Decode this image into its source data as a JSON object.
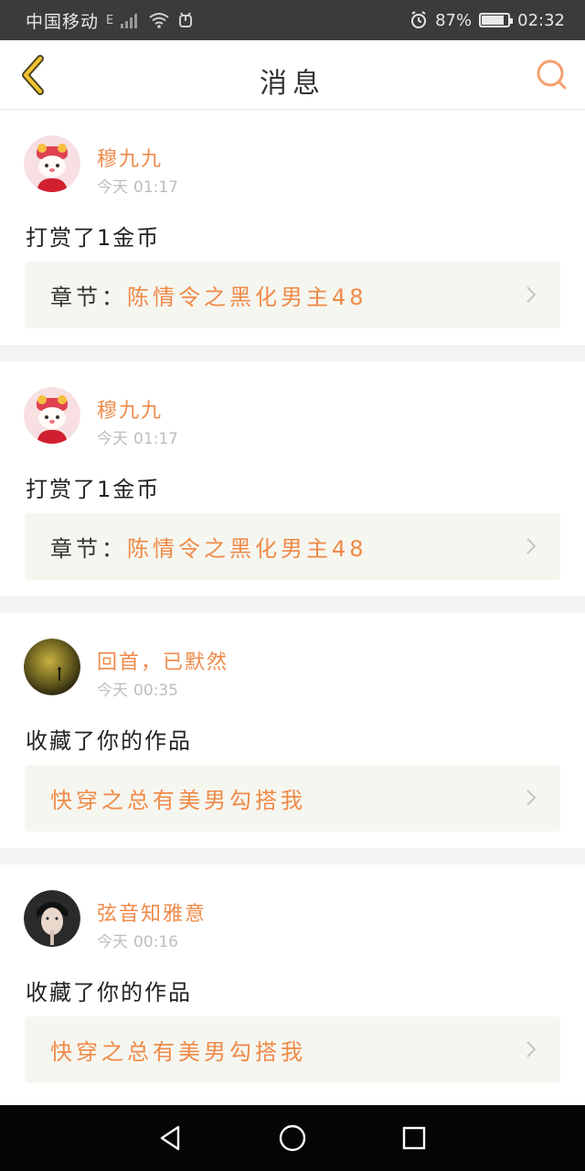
{
  "status_bar": {
    "carrier": "中国移动",
    "network": "E",
    "battery": "87%",
    "battery_level": 0.87,
    "time": "02:32"
  },
  "header": {
    "title": "消息",
    "back_icon": "chevron-left-icon",
    "search_icon": "search-icon"
  },
  "colors": {
    "accent": "#ef8a48",
    "text": "#222222",
    "muted": "#bdbdbd",
    "box_bg": "#f6f6f0"
  },
  "messages": [
    {
      "username": "穆九九",
      "date": "今天",
      "time": "01:17",
      "action": "打赏了1金币",
      "work_label": "章节：",
      "work_title": "陈情令之黑化男主48"
    },
    {
      "username": "穆九九",
      "date": "今天",
      "time": "01:17",
      "action": "打赏了1金币",
      "work_label": "章节：",
      "work_title": "陈情令之黑化男主48"
    },
    {
      "username": "回首，已默然",
      "date": "今天",
      "time": "00:35",
      "action": "收藏了你的作品",
      "work_label": "",
      "work_title": "快穿之总有美男勾搭我"
    },
    {
      "username": "弦音知雅意",
      "date": "今天",
      "time": "00:16",
      "action": "收藏了你的作品",
      "work_label": "",
      "work_title": "快穿之总有美男勾搭我"
    }
  ],
  "nav_bar": {
    "back": "triangle-back-icon",
    "home": "circle-home-icon",
    "recents": "square-recents-icon"
  }
}
